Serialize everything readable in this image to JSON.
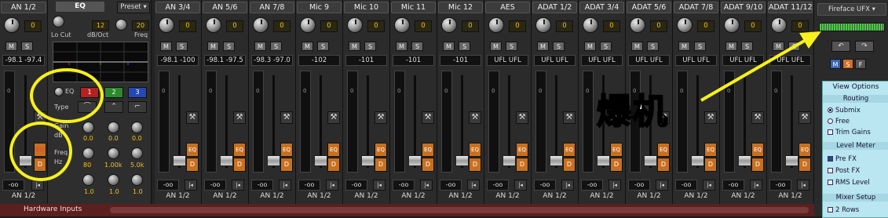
{
  "colors": {
    "strip_bg": "#2b2b2b",
    "orange_button": "#c87020",
    "gain_text": "#f0c020",
    "bottom_bar": "#5a1f1f",
    "view_options_bg": "#b9e6f0",
    "annotation_yellow": "#f7f01a",
    "level_led": "#53c44d"
  },
  "first_strip": {
    "name": "AN 1/2",
    "gain": "0",
    "mute": "M",
    "solo": "S",
    "peak": "-98.1 -97.4",
    "scale_mark": "0",
    "eq_button": "EQ",
    "d_button": "D",
    "volume": "-oo",
    "stereo": "|◂",
    "output": "AN 1/2"
  },
  "eq_panel": {
    "tab": "EQ",
    "preset": "Preset",
    "lo_cut": "Lo Cut",
    "db_oct": "dB/Oct",
    "freq_top": "Freq",
    "val_db": "12",
    "val_freq": "20",
    "eq_toggle": "EQ",
    "bands": [
      {
        "label": "1",
        "color": "#b52020"
      },
      {
        "label": "2",
        "color": "#2a8a2a"
      },
      {
        "label": "3",
        "color": "#2448b5"
      }
    ],
    "type_label": "Type",
    "shapes": [
      "⌒",
      "⌃",
      "⌐"
    ],
    "gain_label": "Gain",
    "db_label": "dB",
    "freq_label": "Freq",
    "hz_label": "Hz",
    "gain_values": [
      "0.0",
      "0.0",
      "0.0"
    ],
    "freq_values": [
      "80",
      "1.00k",
      "5.0k"
    ],
    "q_values": [
      "1.0",
      "1.0",
      "1.0"
    ]
  },
  "strips": [
    {
      "name": "AN 3/4",
      "peak": "-98.1 -100",
      "gain": "0"
    },
    {
      "name": "AN 5/6",
      "peak": "-98.1 -97.5",
      "gain": "0"
    },
    {
      "name": "AN 7/8",
      "peak": "-98.3 -97.0",
      "gain": "0"
    },
    {
      "name": "Mic 9",
      "peak": "-102",
      "gain": "0"
    },
    {
      "name": "Mic 10",
      "peak": "-101",
      "gain": "0"
    },
    {
      "name": "Mic 11",
      "peak": "-101",
      "gain": "0"
    },
    {
      "name": "Mic 12",
      "peak": "-101",
      "gain": "0"
    },
    {
      "name": "AES",
      "peak": "UFL  UFL",
      "gain": "0"
    },
    {
      "name": "ADAT 1/2",
      "peak": "UFL  UFL",
      "gain": "0"
    },
    {
      "name": "ADAT 3/4",
      "peak": "UFL  UFL",
      "gain": "0"
    },
    {
      "name": "ADAT 5/6",
      "peak": "UFL  UFL",
      "gain": "0"
    },
    {
      "name": "ADAT 7/8",
      "peak": "UFL  UFL",
      "gain": "0"
    },
    {
      "name": "ADAT 9/10",
      "peak": "UFL  UFL",
      "gain": "0"
    },
    {
      "name": "ADAT 11/12",
      "peak": "UFL  UFL",
      "gain": "0"
    }
  ],
  "strip_common": {
    "mute": "M",
    "solo": "S",
    "scale_mark": "0",
    "eq_button": "EQ",
    "d_button": "D",
    "volume": "-oo",
    "stereo": "|◂",
    "output": "AN 1/2",
    "wrench": "⚒"
  },
  "right_panel": {
    "device": "Fireface UFX ▾",
    "undo": "↶",
    "redo": "↷",
    "m": "M",
    "s": "S",
    "f": "F",
    "view_options": "View Options",
    "routing": "Routing",
    "routing_options": [
      {
        "label": "Submix",
        "checked": true
      },
      {
        "label": "Free",
        "checked": false
      }
    ],
    "trim_gains": "Trim Gains",
    "level_meter": "Level Meter",
    "level_options": [
      {
        "label": "Pre FX",
        "checked": true
      },
      {
        "label": "Post FX",
        "checked": false
      },
      {
        "label": "RMS Level",
        "checked": false
      }
    ],
    "mixer_setup": "Mixer Setup",
    "rows": "2 Rows"
  },
  "bottom": {
    "label": "Hardware Inputs"
  },
  "annotation": {
    "text": "爆机"
  }
}
